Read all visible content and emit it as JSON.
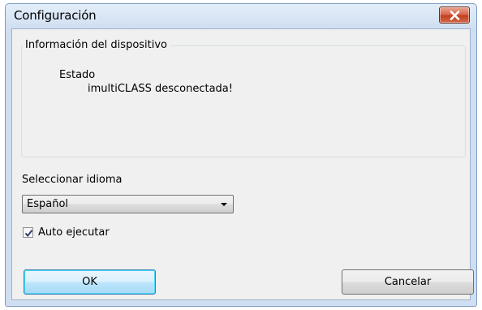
{
  "window": {
    "title": "Configuración"
  },
  "device_group": {
    "legend": "Información del dispositivo",
    "state_label": "Estado",
    "state_value": "imultiCLASS desconectada!"
  },
  "language": {
    "label": "Seleccionar idioma",
    "selected": "Español"
  },
  "auto_run": {
    "label": "Auto ejecutar",
    "checked": true
  },
  "buttons": {
    "ok": "OK",
    "cancel": "Cancelar"
  },
  "icons": {
    "close": "close-icon",
    "dropdown": "chevron-down-icon",
    "checkmark": "checkmark-icon"
  },
  "colors": {
    "close_button": "#d9694f",
    "ok_button_border": "#3c7fb1",
    "titlebar": "#cfdff1"
  }
}
